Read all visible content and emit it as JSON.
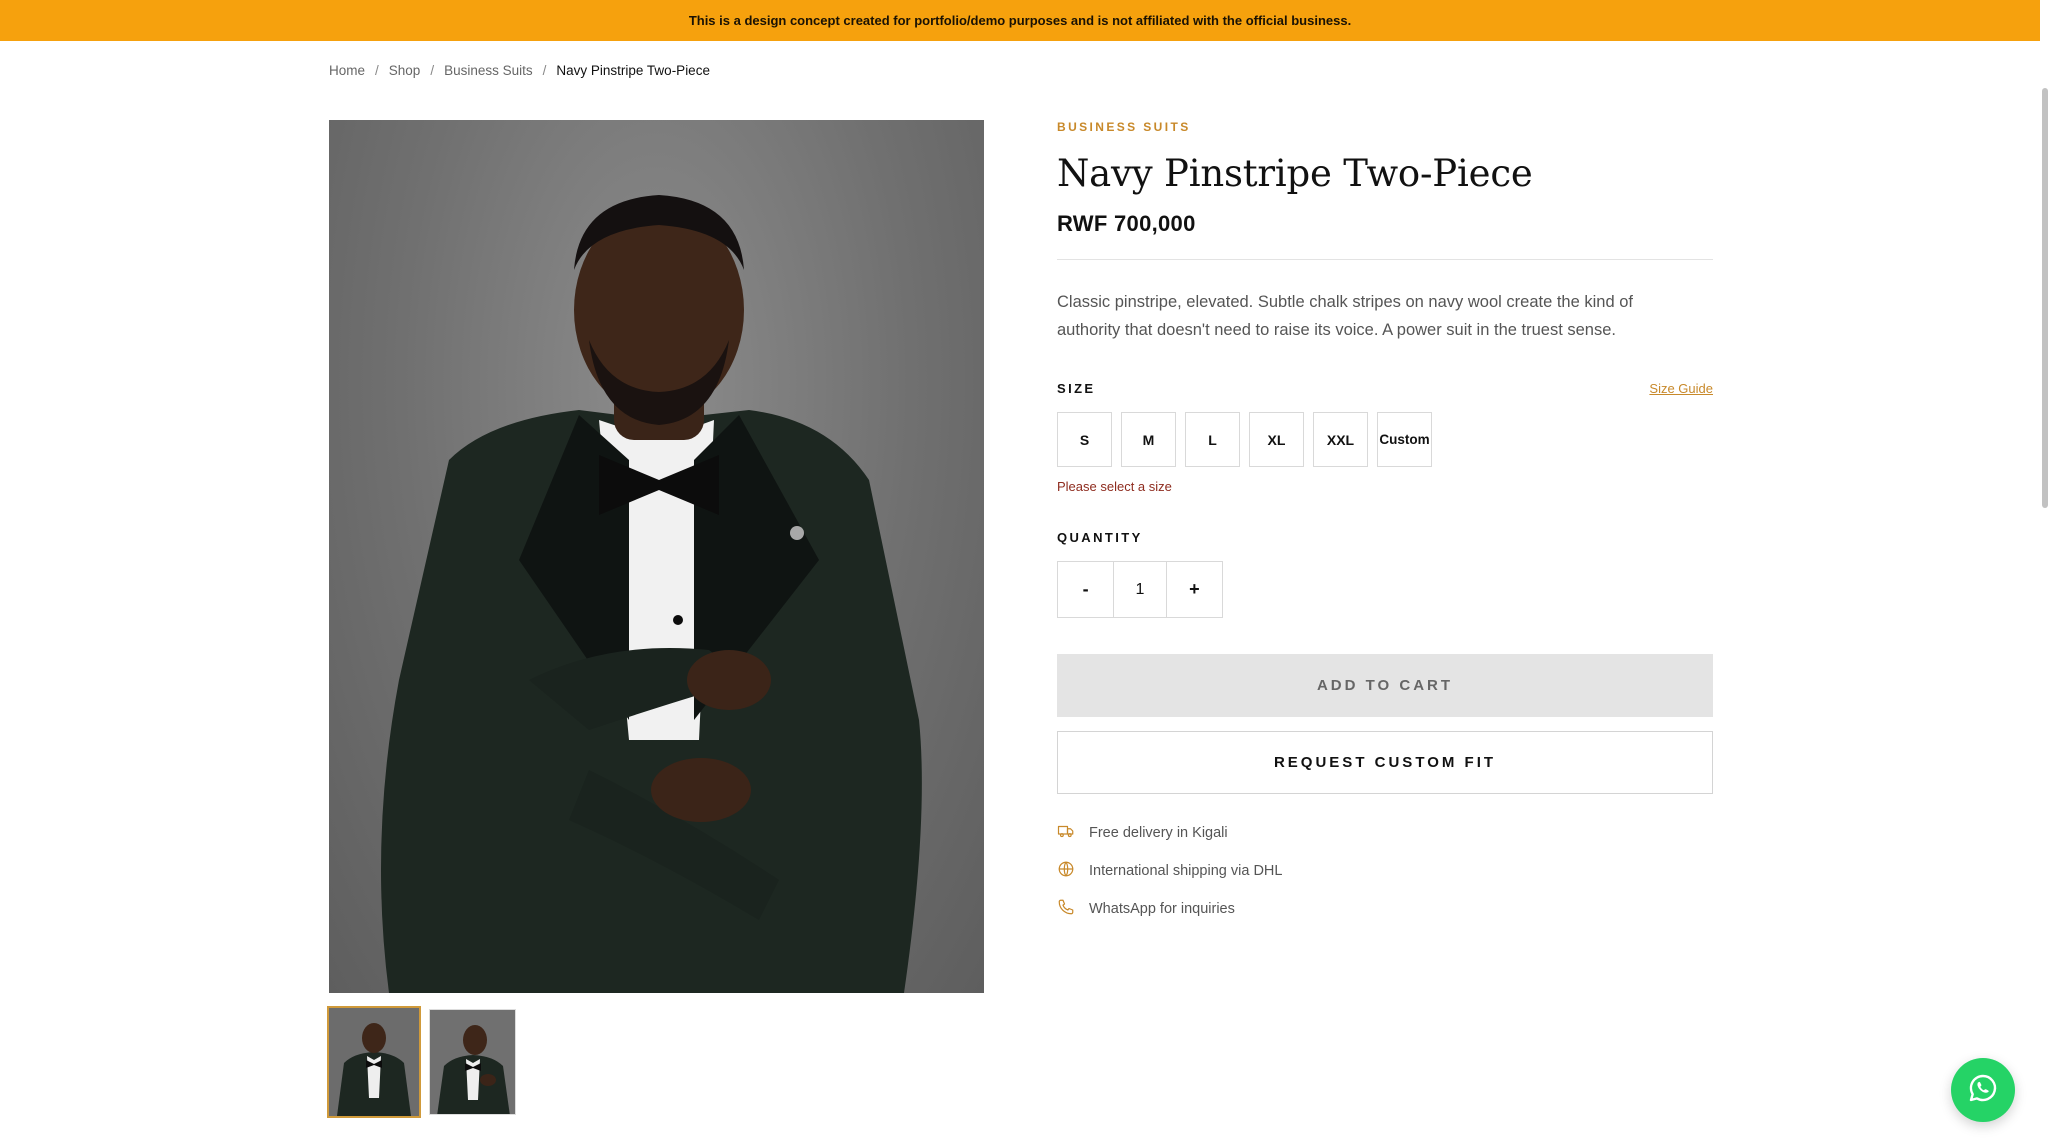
{
  "banner": {
    "text": "This is a design concept created for portfolio/demo purposes and is not affiliated with the official business."
  },
  "breadcrumb": {
    "items": [
      "Home",
      "Shop",
      "Business Suits"
    ],
    "separator": "/",
    "current": "Navy Pinstripe Two-Piece"
  },
  "product": {
    "category": "BUSINESS SUITS",
    "title": "Navy Pinstripe Two-Piece",
    "price": "RWF 700,000",
    "description": "Classic pinstripe, elevated. Subtle chalk stripes on navy wool create the kind of authority that doesn't need to raise its voice. A power suit in the truest sense."
  },
  "size": {
    "label": "SIZE",
    "guide_label": "Size Guide",
    "options": [
      "S",
      "M",
      "L",
      "XL",
      "XXL",
      "Custom"
    ],
    "error": "Please select a size"
  },
  "quantity": {
    "label": "QUANTITY",
    "minus": "-",
    "value": "1",
    "plus": "+"
  },
  "actions": {
    "add_to_cart": "ADD TO CART",
    "request_custom_fit": "REQUEST CUSTOM FIT"
  },
  "features": [
    {
      "icon": "truck-icon",
      "text": "Free delivery in Kigali"
    },
    {
      "icon": "globe-icon",
      "text": "International shipping via DHL"
    },
    {
      "icon": "phone-icon",
      "text": "WhatsApp for inquiries"
    }
  ],
  "colors": {
    "banner": "#f6a10d",
    "accent": "#c8892a",
    "error": "#8e2b1e",
    "whatsapp": "#25d366"
  },
  "gallery": {
    "thumbnail_count": 2,
    "active_index": 0
  }
}
